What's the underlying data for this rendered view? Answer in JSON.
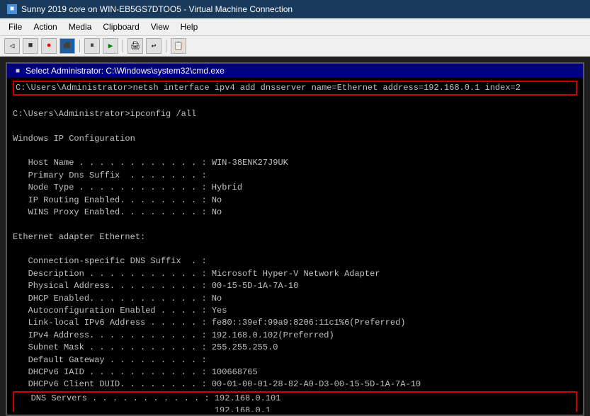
{
  "titlebar": {
    "text": "Sunny 2019 core on WIN-EB5GS7DTOO5 - Virtual Machine Connection",
    "icon": "■"
  },
  "menubar": {
    "items": [
      "File",
      "Action",
      "Media",
      "Clipboard",
      "View",
      "Help"
    ]
  },
  "toolbar": {
    "buttons": [
      "⟨",
      "■",
      "●",
      "⏸",
      "▶",
      "🖨",
      "↩",
      "📋"
    ]
  },
  "cmd": {
    "titlebar": "Select Administrator: C:\\Windows\\system32\\cmd.exe",
    "lines": [
      "C:\\Users\\Administrator>netsh interface ipv4 add dnsserver name=Ethernet address=192.168.0.1 index=2",
      "",
      "C:\\Users\\Administrator>ipconfig /all",
      "",
      "Windows IP Configuration",
      "",
      "   Host Name . . . . . . . . . . . . : WIN-38ENK27J9UK",
      "   Primary Dns Suffix  . . . . . . . :",
      "   Node Type . . . . . . . . . . . . : Hybrid",
      "   IP Routing Enabled. . . . . . . . : No",
      "   WINS Proxy Enabled. . . . . . . . : No",
      "",
      "Ethernet adapter Ethernet:",
      "",
      "   Connection-specific DNS Suffix  . :",
      "   Description . . . . . . . . . . . : Microsoft Hyper-V Network Adapter",
      "   Physical Address. . . . . . . . . : 00-15-5D-1A-7A-10",
      "   DHCP Enabled. . . . . . . . . . . : No",
      "   Autoconfiguration Enabled . . . . : Yes",
      "   Link-local IPv6 Address . . . . . : fe80::39ef:99a9:8206:11c1%6(Preferred)",
      "   IPv4 Address. . . . . . . . . . . : 192.168.0.102(Preferred)",
      "   Subnet Mask . . . . . . . . . . . : 255.255.255.0",
      "   Default Gateway . . . . . . . . . :",
      "   DHCPv6 IAID . . . . . . . . . . . : 100668765",
      "   DHCPv6 Client DUID. . . . . . . . : 00-01-00-01-28-82-A0-D3-00-15-5D-1A-7A-10",
      "   DNS Servers . . . . . . . . . . . : 192.168.0.101",
      "                                       192.168.0.1"
    ],
    "netsh_line": "netsh interface ipv4 add dnsserver name=Ethernet address=192.168.0.1 index=2",
    "prompt": "C:\\Users\\Administrator>"
  }
}
